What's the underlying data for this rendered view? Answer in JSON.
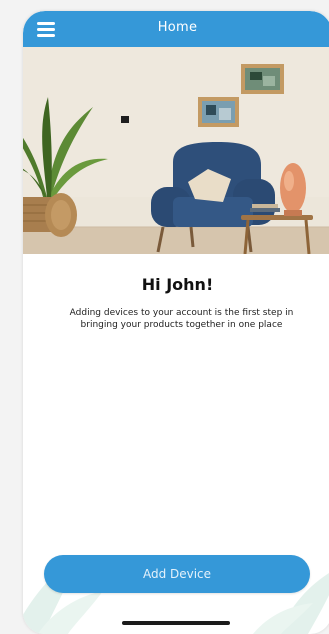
{
  "header": {
    "title": "Home",
    "menu_icon": "hamburger-menu-icon",
    "background_color": "#3598d8"
  },
  "hero_image": {
    "subject": "living room with blue armchair, potted palm and lamp"
  },
  "content": {
    "greeting": "Hi John!",
    "description": "Adding devices to your account is the first step in bringing your products together in one place"
  },
  "actions": {
    "add_device_label": "Add Device",
    "button_color": "#3598d8"
  }
}
